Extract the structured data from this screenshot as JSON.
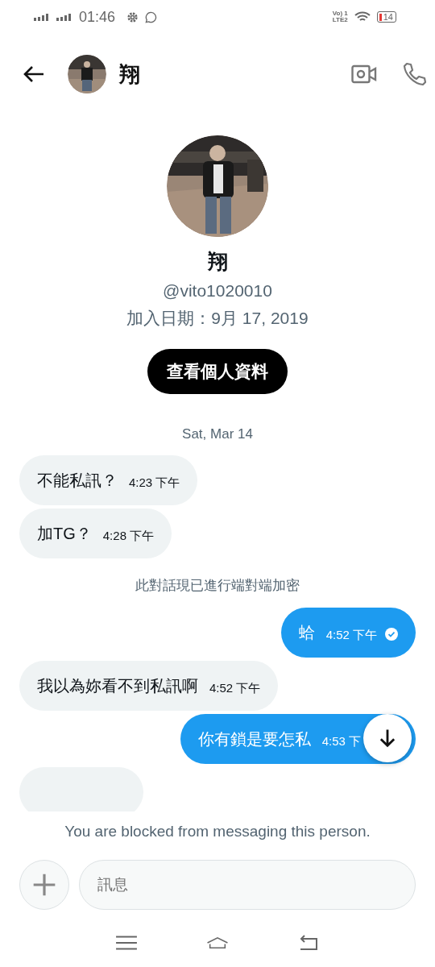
{
  "status_bar": {
    "time": "01:46",
    "network": "Vo) 1\nLTE2",
    "battery": "14"
  },
  "header": {
    "name": "翔"
  },
  "profile": {
    "name": "翔",
    "handle": "@vito1020010",
    "joined": "加入日期：9月 17, 2019",
    "button": "查看個人資料"
  },
  "chat": {
    "date": "Sat, Mar 14",
    "items": [
      {
        "kind": "received",
        "text": "不能私訊？",
        "time": "4:23 下午"
      },
      {
        "kind": "received",
        "text": "加TG？",
        "time": "4:28 下午"
      },
      {
        "kind": "notice",
        "text": "此對話現已進行端對端加密"
      },
      {
        "kind": "sent",
        "text": "蛤",
        "time": "4:52 下午",
        "read": true
      },
      {
        "kind": "received",
        "text": "我以為妳看不到私訊啊",
        "time": "4:52 下午"
      },
      {
        "kind": "sent",
        "text": "你有鎖是要怎私",
        "time": "4:53 下",
        "read": false
      },
      {
        "kind": "partial"
      }
    ]
  },
  "blocked_notice": "You are blocked from messaging this person.",
  "composer": {
    "placeholder": "訊息"
  }
}
